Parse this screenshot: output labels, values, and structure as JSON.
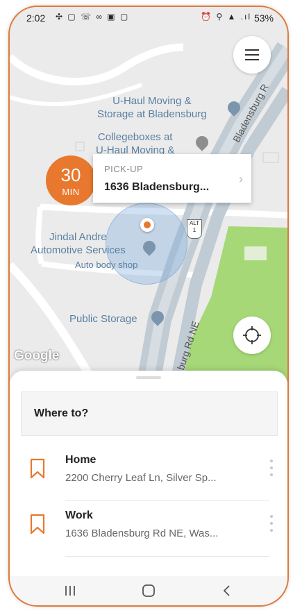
{
  "status_bar": {
    "time": "2:02",
    "left_icons": [
      "grid-icon",
      "chat-icon",
      "voicemail-icon",
      "link-icon",
      "photo-icon",
      "square-icon"
    ],
    "right_icons": [
      "alarm-icon",
      "location-icon",
      "volte-icon",
      "signal-icon"
    ],
    "battery": "53%"
  },
  "map": {
    "labels": {
      "uhaul": "U-Haul Moving &\nStorage at Bladensburg",
      "collegeboxes": "Collegeboxes at\nU-Haul Moving &",
      "jindal": "Jindal Andre\nAutomotive Services",
      "jindal_sub": "Auto body shop",
      "public_storage": "Public Storage",
      "road_upper": "Bladensburg R",
      "road_lower": "burg Rd NE",
      "route_shield": "ALT\n1",
      "google_logo": "Google"
    }
  },
  "pickup": {
    "eta_value": "30",
    "eta_unit": "MIN",
    "label": "PICK-UP",
    "address": "1636 Bladensburg..."
  },
  "sheet": {
    "search_placeholder": "Where to?",
    "places": [
      {
        "title": "Home",
        "address": "2200 Cherry Leaf Ln, Silver Sp..."
      },
      {
        "title": "Work",
        "address": "1636 Bladensburg Rd NE, Was..."
      }
    ]
  },
  "colors": {
    "accent": "#e8782e",
    "park": "#a6d878",
    "road_major": "#c0cbd3"
  },
  "icons": {
    "menu": "hamburger-icon",
    "locate": "crosshair-icon",
    "place": "bookmark-icon",
    "more": "kebab-icon"
  }
}
